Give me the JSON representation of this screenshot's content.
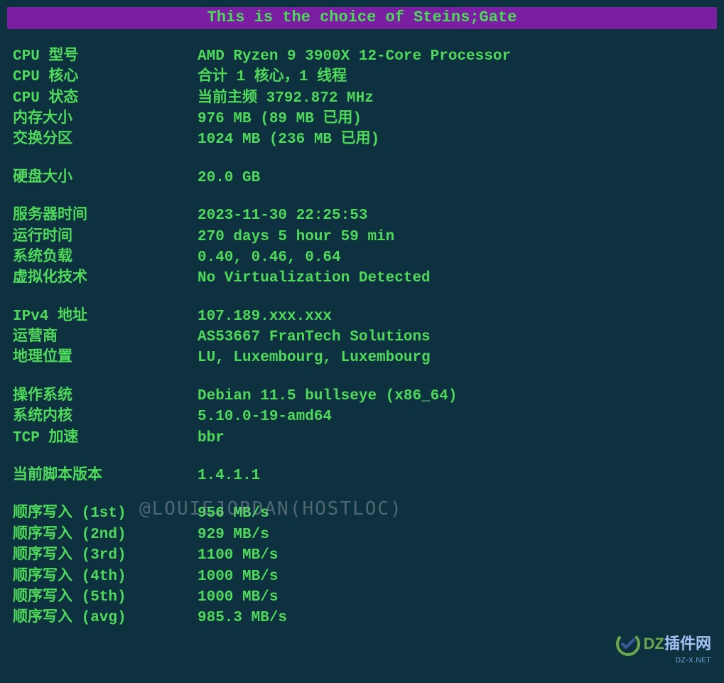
{
  "title": "This is the choice of Steins;Gate",
  "section1": {
    "cpu_model_label": "CPU 型号",
    "cpu_model_value": "AMD Ryzen 9 3900X 12-Core Processor",
    "cpu_cores_label": "CPU 核心",
    "cpu_cores_value": "合计 1 核心，1 线程",
    "cpu_status_label": "CPU 状态",
    "cpu_status_value": "当前主频 3792.872 MHz",
    "memory_label": "内存大小",
    "memory_value": "976 MB (89 MB 已用)",
    "swap_label": "交换分区",
    "swap_value": "1024 MB (236 MB 已用)"
  },
  "section2": {
    "disk_label": "硬盘大小",
    "disk_value": "20.0 GB"
  },
  "section3": {
    "server_time_label": "服务器时间",
    "server_time_value": "2023-11-30 22:25:53",
    "uptime_label": "运行时间",
    "uptime_value": "270 days 5 hour 59 min",
    "load_label": "系统负载",
    "load_value": "0.40, 0.46, 0.64",
    "virtualization_label": "虚拟化技术",
    "virtualization_value": "No Virtualization Detected"
  },
  "section4": {
    "ipv4_label": "IPv4 地址",
    "ipv4_value": "107.189.xxx.xxx",
    "isp_label": "运营商",
    "isp_value": "AS53667 FranTech Solutions",
    "location_label": "地理位置",
    "location_value": "LU, Luxembourg, Luxembourg"
  },
  "section5": {
    "os_label": "操作系统",
    "os_value": "Debian 11.5 bullseye (x86_64)",
    "kernel_label": "系统内核",
    "kernel_value": "5.10.0-19-amd64",
    "tcp_label": "TCP 加速",
    "tcp_value": "bbr"
  },
  "section6": {
    "version_label": "当前脚本版本",
    "version_value": "1.4.1.1"
  },
  "section7": {
    "write1_label": "顺序写入 (1st)",
    "write1_value": "956 MB/s",
    "write2_label": "顺序写入 (2nd)",
    "write2_value": "929 MB/s",
    "write3_label": "顺序写入 (3rd)",
    "write3_value": "1100 MB/s",
    "write4_label": "顺序写入 (4th)",
    "write4_value": "1000 MB/s",
    "write5_label": "顺序写入 (5th)",
    "write5_value": "1000 MB/s",
    "writeavg_label": "顺序写入 (avg)",
    "writeavg_value": "985.3 MB/s"
  },
  "watermark": "@LOUIEJORDAN(HOSTLOC)",
  "logo": {
    "dz": "DZ",
    "rest": "插件网",
    "url": "DZ-X.NET"
  }
}
